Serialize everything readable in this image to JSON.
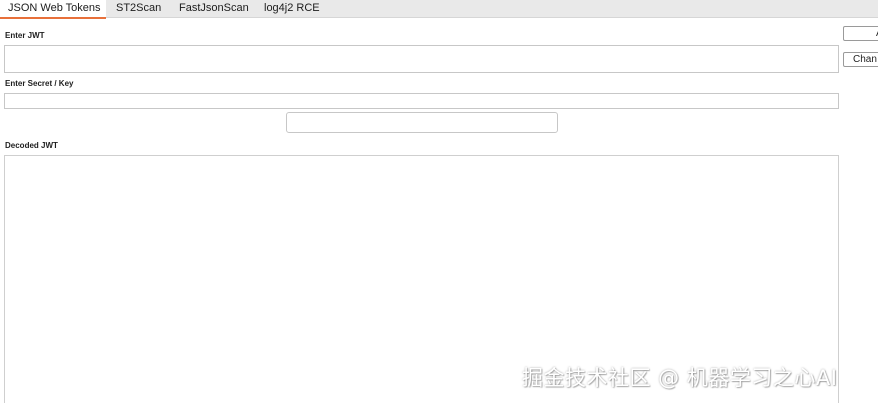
{
  "tabs": [
    {
      "label": "JSON Web Tokens",
      "active": true
    },
    {
      "label": "ST2Scan",
      "active": false
    },
    {
      "label": "FastJsonScan",
      "active": false
    },
    {
      "label": "log4j2 RCE",
      "active": false
    }
  ],
  "labels": {
    "enter_jwt": "Enter JWT",
    "enter_secret": "Enter Secret / Key",
    "decoded_jwt": "Decoded JWT"
  },
  "inputs": {
    "jwt_value": "",
    "secret_value": "",
    "middle_value": "",
    "decoded_value": ""
  },
  "buttons": {
    "top_right_label": "A",
    "change_label": "Chan"
  },
  "watermark": "掘金技术社区 @ 机器学习之心AI",
  "colors": {
    "accent": "#e8703a",
    "tabbar_bg": "#e9e9e9",
    "border": "#c7c7c7"
  }
}
